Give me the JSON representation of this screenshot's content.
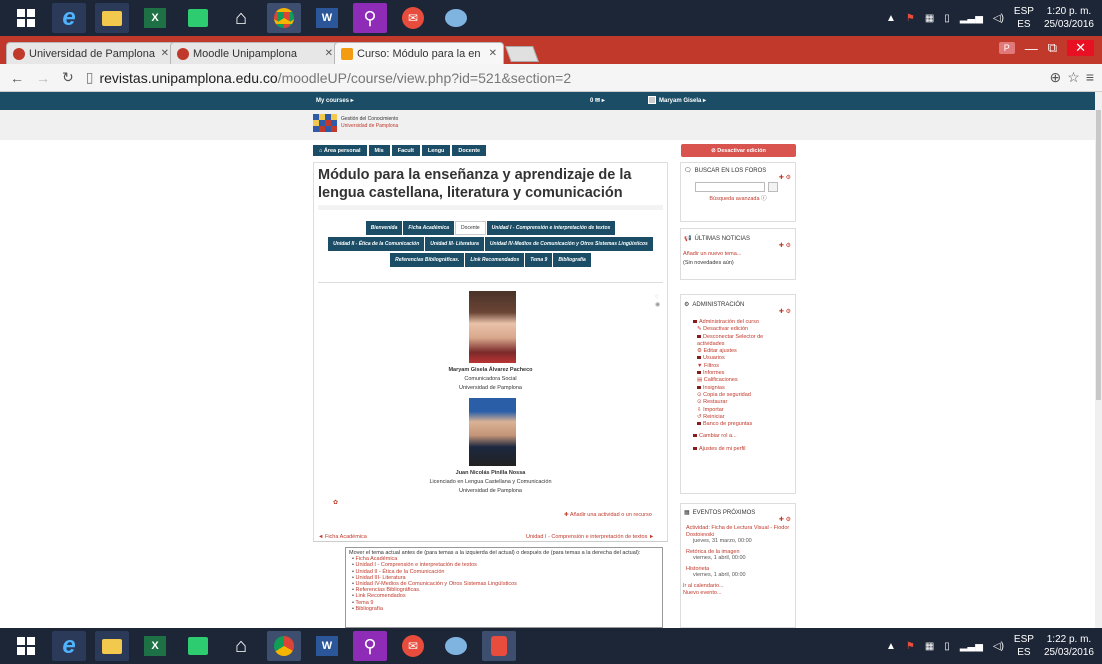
{
  "taskbar_top": {
    "lang_code": "ESP",
    "lang_sub": "ES",
    "time": "1:20 p. m.",
    "date": "25/03/2016",
    "apps": [
      "windows-start-icon",
      "ie-icon",
      "file-explorer-icon",
      "excel-icon",
      "store-icon",
      "home-icon",
      "chrome-icon",
      "word-icon",
      "search-app-icon",
      "mail-icon",
      "paint-icon"
    ]
  },
  "taskbar_bottom": {
    "lang_code": "ESP",
    "lang_sub": "ES",
    "time": "1:22 p. m.",
    "date": "25/03/2016"
  },
  "browser": {
    "tabs": [
      {
        "label": "Universidad de Pamplona"
      },
      {
        "label": "Moodle Unipamplona"
      },
      {
        "label": "Curso: Módulo para la en"
      }
    ],
    "url_host": "revistas.unipamplona.edu.co",
    "url_path": "/moodleUP/course/view.php?id=521&section=2",
    "profile_letter": "P"
  },
  "moodle_bar": {
    "my_courses": "My courses ▸",
    "messages": "0 ✉ ▸",
    "user": "Maryam Gisela ▸"
  },
  "logo": {
    "line1": "Gestión del Conocimiento",
    "line2": "Universidad de Pamplona"
  },
  "breadcrumb": [
    "⌂ Área personal",
    "Mis",
    "Facult",
    "Lengu",
    "Docente"
  ],
  "edit_button": "⊘ Desactivar edición",
  "course": {
    "title": "Módulo para la enseñanza y aprendizaje de la lengua castellana, literatura y comunicación",
    "tabs": [
      {
        "label": "Bienvenida",
        "current": false
      },
      {
        "label": "Ficha Académica",
        "current": false
      },
      {
        "label": "Docente",
        "current": true
      },
      {
        "label": "Unidad I - Comprensión e interpretación de textos",
        "current": false
      },
      {
        "label": "Unidad II - Ética de la Comunicación",
        "current": false
      },
      {
        "label": "Unidad III- Literatura",
        "current": false
      },
      {
        "label": "Unidad IV-Medios de Comunicación y Otros Sistemas Lingüísticos",
        "current": false
      },
      {
        "label": "Referencias Bibliográficas.",
        "current": false
      },
      {
        "label": "Link Recomendados",
        "current": false
      },
      {
        "label": "Tema 9",
        "current": false
      },
      {
        "label": "Bibliografía",
        "current": false
      }
    ],
    "person1": {
      "name": "Maryam Gisela Álvarez Pacheco",
      "role": "Comunicadora Social",
      "org": "Universidad de Pamplona"
    },
    "person2": {
      "name": "Juan Nicolás Pinilla Nossa",
      "role": "Licenciado en Lengua Castellana y Comunicación",
      "org": "Universidad de Pamplona"
    },
    "add_activity": "✚ Añadir una actividad o un recurso",
    "nav_prev": "◄ Ficha Académica",
    "nav_next": "Unidad I - Comprensión e interpretación de textos ►"
  },
  "move_box": {
    "intro": "Mover el tema actual antes de (para temas a la izquierda del actual) o después de (para temas a la derecha del actual):",
    "items": [
      "Ficha Académica",
      "Unidad I - Comprensión e interpretación de textos",
      "Unidad II - Ética de la Comunicación",
      "Unidad III- Literatura",
      "Unidad IV-Medios de Comunicación y Otros Sistemas Lingüísticos",
      "Referencias Bibliográficas.",
      "Link Recomendados",
      "Tema 9",
      "Bibliografía"
    ]
  },
  "blocks": {
    "search": {
      "title": "BUSCAR EN LOS FOROS",
      "advanced": "Búsqueda avanzada",
      "go": "Ir"
    },
    "news": {
      "title": "ÚLTIMAS NOTICIAS",
      "add": "Añadir un nuevo tema...",
      "empty": "(Sin novedades aún)"
    },
    "admin": {
      "title": "ADMINISTRACIÓN",
      "items": [
        {
          "label": "Administración del curso",
          "level": "l1"
        },
        {
          "label": "Desactivar edición",
          "level": "l2"
        },
        {
          "label": "Desconectar Selector de actividades",
          "level": "l2"
        },
        {
          "label": "Editar ajustes",
          "level": "l2"
        },
        {
          "label": "Usuarios",
          "level": "l2"
        },
        {
          "label": "Filtros",
          "level": "l2"
        },
        {
          "label": "Informes",
          "level": "l2"
        },
        {
          "label": "Calificaciones",
          "level": "l2"
        },
        {
          "label": "Insignias",
          "level": "l2"
        },
        {
          "label": "Copia de seguridad",
          "level": "l2"
        },
        {
          "label": "Restaurar",
          "level": "l2"
        },
        {
          "label": "Importar",
          "level": "l2"
        },
        {
          "label": "Reiniciar",
          "level": "l2"
        },
        {
          "label": "Banco de preguntas",
          "level": "l2"
        },
        {
          "label": "Cambiar rol a...",
          "level": "l1"
        },
        {
          "label": "Ajustes de mi perfil",
          "level": "l1"
        }
      ]
    },
    "events": {
      "title": "EVENTOS PRÓXIMOS",
      "items": [
        {
          "title": "Actividad: Ficha de Lectura Visual - Fiodor Dostoievski",
          "date": "jueves, 31 marzo, 00:00"
        },
        {
          "title": "Retórica de la imagen",
          "date": "viernes, 1 abril, 00:00"
        },
        {
          "title": "Historieta",
          "date": "viernes, 1 abril, 00:00"
        }
      ],
      "calendar": "Ir al calendario...",
      "new_event": "Nuevo evento..."
    }
  },
  "colors": {
    "taskbar": "#1d2637",
    "tabbar": "#c0392b",
    "moodle_nav": "#1b4e66",
    "accent": "#c0392b"
  }
}
